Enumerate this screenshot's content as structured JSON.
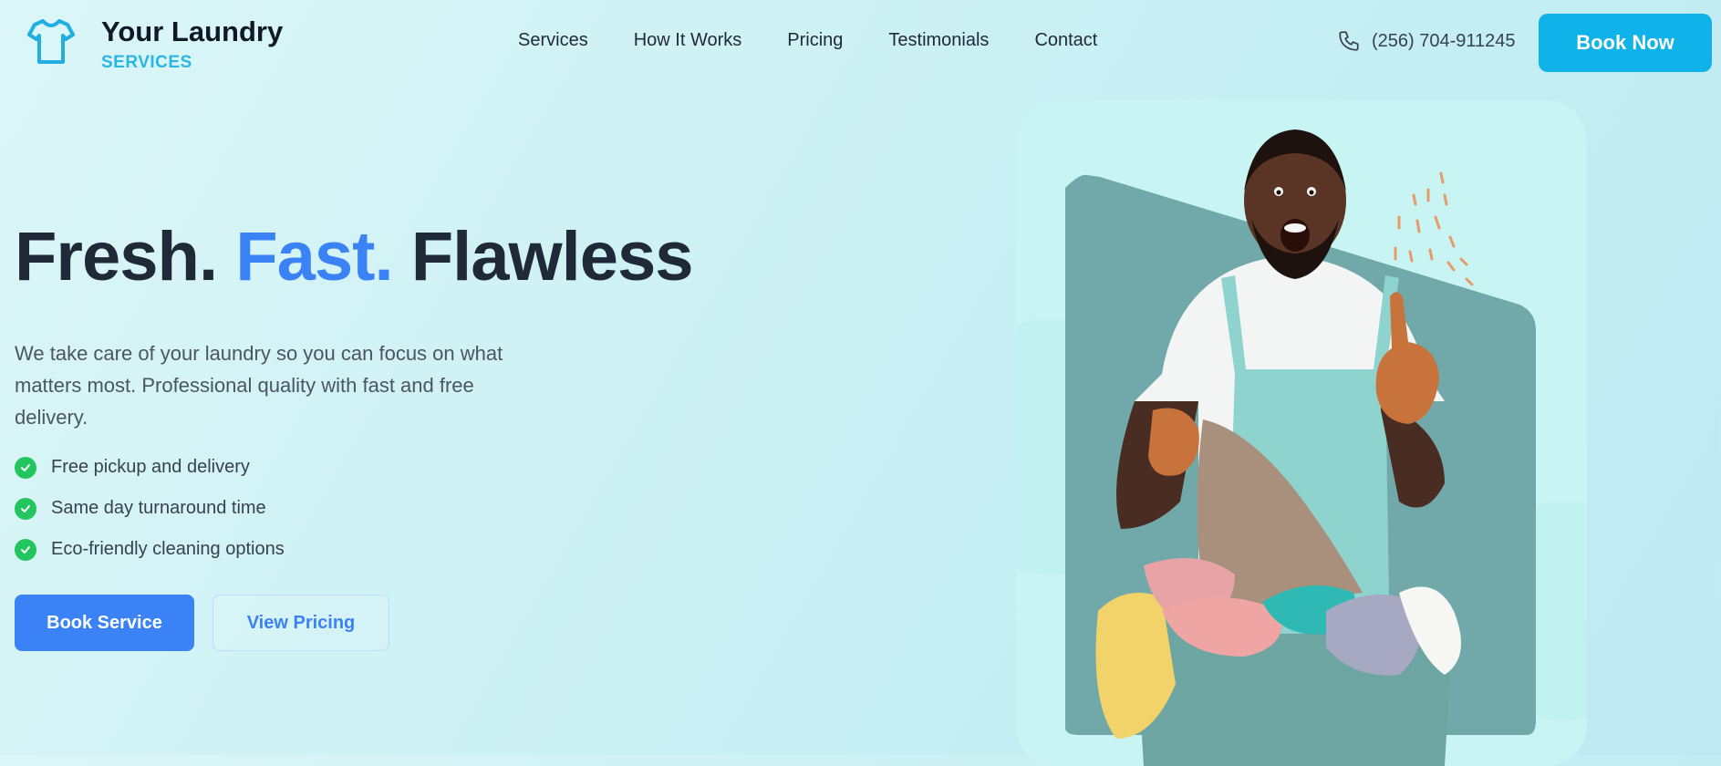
{
  "brand": {
    "name": "Your Laundry",
    "subtitle": "SERVICES",
    "logo_icon": "tshirt-icon"
  },
  "nav": {
    "items": [
      "Services",
      "How It Works",
      "Pricing",
      "Testimonials",
      "Contact"
    ]
  },
  "header": {
    "phone": "(256) 704-911245",
    "phone_icon": "phone-icon",
    "book_now_label": "Book Now"
  },
  "hero": {
    "title_part1": "Fresh.",
    "title_part2": "Fast.",
    "title_part3": "Flawless",
    "description": "We take care of your laundry so you can focus on what matters most. Professional quality with fast and free delivery.",
    "features": [
      "Free pickup and delivery",
      "Same day turnaround time",
      "Eco-friendly cleaning options"
    ],
    "primary_button": "Book Service",
    "secondary_button": "View Pricing"
  },
  "colors": {
    "accent": "#3b82f6",
    "brand_cyan": "#10b2ea",
    "check_green": "#22c55e",
    "title_dark": "#1f2937"
  }
}
